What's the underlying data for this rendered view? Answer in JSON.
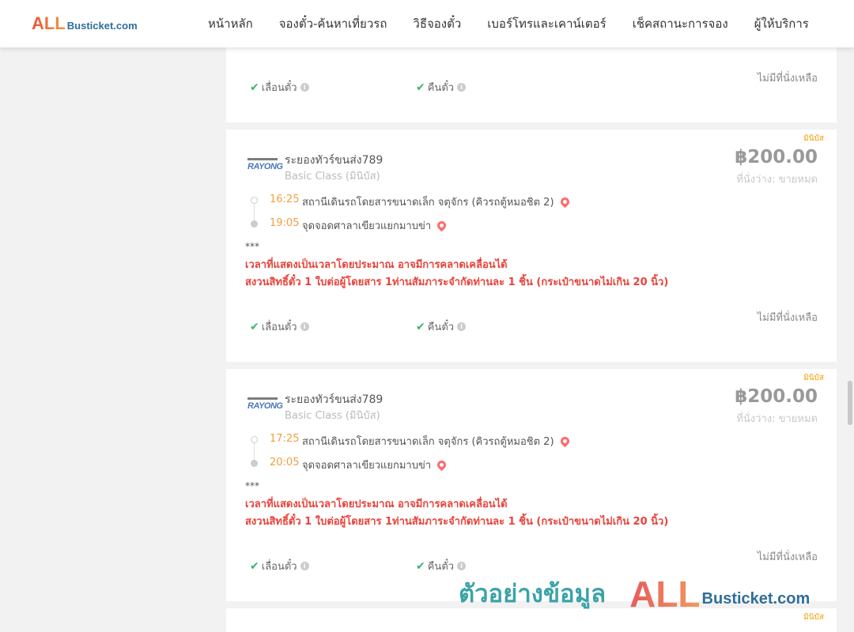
{
  "header": {
    "logo_all": "ALL",
    "logo_busticket": "Busticket.com",
    "nav": [
      "หน้าหลัก",
      "จองตั๋ว-ค้นหาเที่ยวรถ",
      "วิธีจองตั๋ว",
      "เบอร์โทรและเคาน์เตอร์",
      "เช็คสถานะการจอง",
      "ผู้ให้บริการ"
    ]
  },
  "top_card": {
    "reschedule": "เลื่อนตั๋ว",
    "refund": "คืนตั๋ว",
    "no_seat": "ไม่มีที่นั่งเหลือ"
  },
  "trips": [
    {
      "tag": "มินิบัส",
      "operator_logo": "RAYONG",
      "operator": "ระยองทัวร์ขนส่ง789",
      "class": "Basic Class (มินิบัส)",
      "price": "฿200.00",
      "seat_status": "ที่นั่งว่าง: ขายหมด",
      "dep_time": "16:25",
      "dep_stop": "สถานีเดินรถโดยสารขนาดเล็ก จตุจักร (คิวรถตู้หมอชิต 2)",
      "arr_time": "19:05",
      "arr_stop": "จุดจอดศาลาเขียวแยกมาบข่า",
      "note_stars": "***",
      "note_1": "เวลาที่แสดงเป็นเวลาโดยประมาณ อาจมีการคลาดเคลื่อนได้",
      "note_2": "สงวนสิทธิ์ตั๋ว 1 ใบต่อผู้โดยสาร 1ท่านสัมภาระจำกัดท่านละ 1 ชิ้น (กระเป๋าขนาดไม่เกิน 20 นิ้ว)",
      "reschedule": "เลื่อนตั๋ว",
      "refund": "คืนตั๋ว",
      "no_seat": "ไม่มีที่นั่งเหลือ"
    },
    {
      "tag": "มินิบัส",
      "operator_logo": "RAYONG",
      "operator": "ระยองทัวร์ขนส่ง789",
      "class": "Basic Class (มินิบัส)",
      "price": "฿200.00",
      "seat_status": "ที่นั่งว่าง: ขายหมด",
      "dep_time": "17:25",
      "dep_stop": "สถานีเดินรถโดยสารขนาดเล็ก จตุจักร (คิวรถตู้หมอชิต 2)",
      "arr_time": "20:05",
      "arr_stop": "จุดจอดศาลาเขียวแยกมาบข่า",
      "note_stars": "***",
      "note_1": "เวลาที่แสดงเป็นเวลาโดยประมาณ อาจมีการคลาดเคลื่อนได้",
      "note_2": "สงวนสิทธิ์ตั๋ว 1 ใบต่อผู้โดยสาร 1ท่านสัมภาระจำกัดท่านละ 1 ชิ้น (กระเป๋าขนาดไม่เกิน 20 นิ้ว)",
      "reschedule": "เลื่อนตั๋ว",
      "refund": "คืนตั๋ว",
      "no_seat": "ไม่มีที่นั่งเหลือ"
    }
  ],
  "bottom_card": {
    "tag": "มินิบัส"
  },
  "watermark": {
    "text": "ตัวอย่างข้อมูล",
    "all": "ALL",
    "busticket": "Busticket.com"
  },
  "colors": {
    "accent_orange": "#f0a040",
    "note_red": "#e8433a",
    "check_green": "#3cb371",
    "watermark_teal": "#3ba3a8"
  },
  "icons": {
    "check": "check-icon",
    "info": "info-icon",
    "pin": "map-pin-icon"
  }
}
